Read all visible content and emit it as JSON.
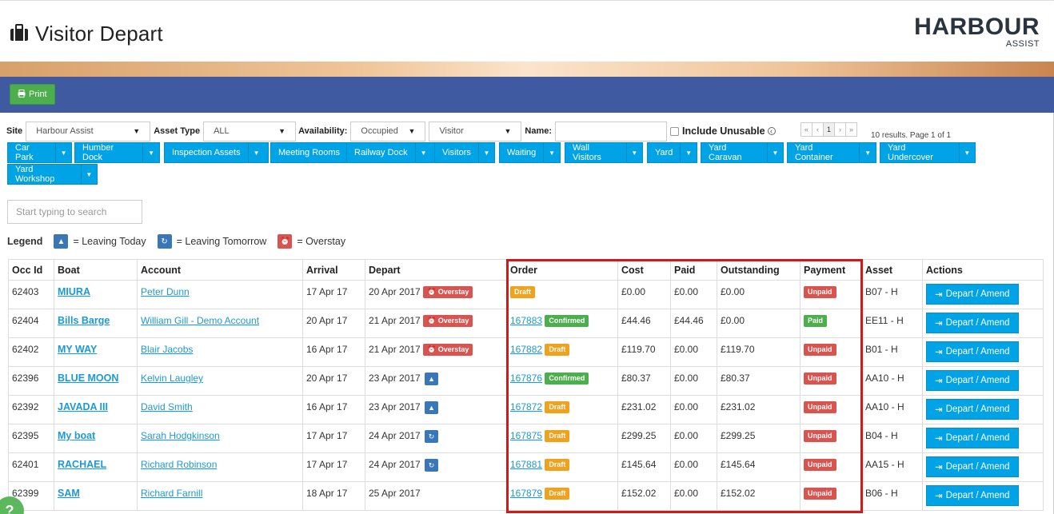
{
  "header": {
    "title": "Visitor Depart",
    "logo_main": "HARBOUR",
    "logo_sub": "ASSIST"
  },
  "toolbar": {
    "print_label": "Print"
  },
  "filters": {
    "site_label": "Site",
    "site_value": "Harbour Assist",
    "asset_type_label": "Asset Type",
    "asset_type_value": "ALL",
    "availability_label": "Availability:",
    "availability_value": "Occupied",
    "type_value": "Visitor",
    "name_label": "Name:",
    "include_unusable_label": "Include Unusable",
    "pager": [
      "«",
      "‹",
      "1",
      "›",
      "»"
    ],
    "results_text": "10 results. Page 1 of 1"
  },
  "categories": [
    {
      "label": "Car Park",
      "dropdown": true
    },
    {
      "label": "Humber Dock",
      "dropdown": true
    },
    {
      "label": "Inspection Assets",
      "dropdown": true
    },
    {
      "label": "Meeting Rooms",
      "dropdown": false
    },
    {
      "label": "Railway Dock",
      "dropdown": true
    },
    {
      "label": "Visitors",
      "dropdown": true
    },
    {
      "label": "Waiting",
      "dropdown": true
    },
    {
      "label": "Wall Visitors",
      "dropdown": true
    },
    {
      "label": "Yard",
      "dropdown": true
    },
    {
      "label": "Yard Caravan",
      "dropdown": true
    },
    {
      "label": "Yard Container",
      "dropdown": true
    },
    {
      "label": "Yard Undercover",
      "dropdown": true
    },
    {
      "label": "Yard Workshop",
      "dropdown": true
    }
  ],
  "search": {
    "placeholder": "Start typing to search"
  },
  "legend": {
    "title": "Legend",
    "leaving_today": "= Leaving Today",
    "leaving_tomorrow": "= Leaving Tomorrow",
    "overstay": "= Overstay"
  },
  "table": {
    "columns": [
      "Occ Id",
      "Boat",
      "Account",
      "Arrival",
      "Depart",
      "Order",
      "Cost",
      "Paid",
      "Outstanding",
      "Payment",
      "Asset",
      "Actions"
    ],
    "action_label": "Depart / Amend",
    "rows": [
      {
        "occ_id": "62403",
        "boat": "MIURA",
        "account": "Peter Dunn",
        "arrival": "17 Apr 17",
        "depart": "20 Apr 2017",
        "depart_status": "Overstay",
        "order_no": "",
        "order_status": "Draft",
        "cost": "£0.00",
        "paid": "£0.00",
        "outstanding": "£0.00",
        "outstanding_red": true,
        "payment": "Unpaid",
        "asset": "B07 - H"
      },
      {
        "occ_id": "62404",
        "boat": "Bills Barge",
        "account": "William Gill - Demo Account",
        "arrival": "20 Apr 17",
        "depart": "21 Apr 2017",
        "depart_status": "Overstay",
        "order_no": "167883",
        "order_status": "Confirmed",
        "cost": "£44.46",
        "paid": "£44.46",
        "outstanding": "£0.00",
        "outstanding_red": false,
        "payment": "Paid",
        "asset": "EE11 - H"
      },
      {
        "occ_id": "62402",
        "boat": "MY WAY",
        "account": "Blair Jacobs",
        "arrival": "16 Apr 17",
        "depart": "21 Apr 2017",
        "depart_status": "Overstay",
        "order_no": "167882",
        "order_status": "Draft",
        "cost": "£119.70",
        "paid": "£0.00",
        "outstanding": "£119.70",
        "outstanding_red": true,
        "payment": "Unpaid",
        "asset": "B01 - H"
      },
      {
        "occ_id": "62396",
        "boat": "BLUE MOON",
        "account": "Kelvin Laugley",
        "arrival": "20 Apr 17",
        "depart": "23 Apr 2017",
        "depart_status": "today",
        "order_no": "167876",
        "order_status": "Confirmed",
        "cost": "£80.37",
        "paid": "£0.00",
        "outstanding": "£80.37",
        "outstanding_red": true,
        "payment": "Unpaid",
        "asset": "AA10 - H"
      },
      {
        "occ_id": "62392",
        "boat": "JAVADA III",
        "account": "David Smith",
        "arrival": "16 Apr 17",
        "depart": "23 Apr 2017",
        "depart_status": "today",
        "order_no": "167872",
        "order_status": "Draft",
        "cost": "£231.02",
        "paid": "£0.00",
        "outstanding": "£231.02",
        "outstanding_red": true,
        "payment": "Unpaid",
        "asset": "AA10 - H"
      },
      {
        "occ_id": "62395",
        "boat": "My boat",
        "account": "Sarah Hodgkinson",
        "arrival": "17 Apr 17",
        "depart": "24 Apr 2017",
        "depart_status": "tomorrow",
        "order_no": "167875",
        "order_status": "Draft",
        "cost": "£299.25",
        "paid": "£0.00",
        "outstanding": "£299.25",
        "outstanding_red": true,
        "payment": "Unpaid",
        "asset": "B04 - H"
      },
      {
        "occ_id": "62401",
        "boat": "RACHAEL",
        "account": "Richard Robinson",
        "arrival": "17 Apr 17",
        "depart": "24 Apr 2017",
        "depart_status": "tomorrow",
        "order_no": "167881",
        "order_status": "Draft",
        "cost": "£145.64",
        "paid": "£0.00",
        "outstanding": "£145.64",
        "outstanding_red": true,
        "payment": "Unpaid",
        "asset": "AA15 - H"
      },
      {
        "occ_id": "62399",
        "boat": "SAM",
        "account": "Richard Farnill",
        "arrival": "18 Apr 17",
        "depart": "25 Apr 2017",
        "depart_status": "",
        "order_no": "167879",
        "order_status": "Draft",
        "cost": "£152.02",
        "paid": "£0.00",
        "outstanding": "£152.02",
        "outstanding_red": true,
        "payment": "Unpaid",
        "asset": "B06 - H"
      }
    ]
  },
  "help_button": "?"
}
